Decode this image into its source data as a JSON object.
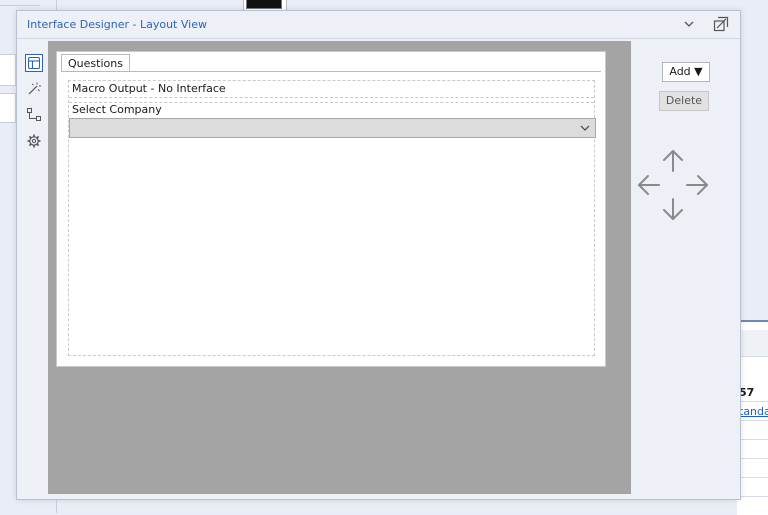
{
  "window": {
    "title": "Interface Designer - Layout View"
  },
  "tools": [
    {
      "icon": "layout-icon",
      "active": true
    },
    {
      "icon": "magic-wand-icon",
      "active": false
    },
    {
      "icon": "tree-icon",
      "active": false
    },
    {
      "icon": "gear-icon",
      "active": false
    }
  ],
  "form": {
    "tab_label": "Questions",
    "macro_output": "Macro Output - No Interface",
    "question_label": "Select Company",
    "dropdown_value": ""
  },
  "controls": {
    "add_label": "Add ▼",
    "delete_label": "Delete"
  },
  "background": {
    "panel_rows": [
      "57",
      "tanda"
    ]
  },
  "colors": {
    "accent": "#2d63b6",
    "canvas": "#a4a4a4",
    "arrow": "#8a8a8a"
  }
}
